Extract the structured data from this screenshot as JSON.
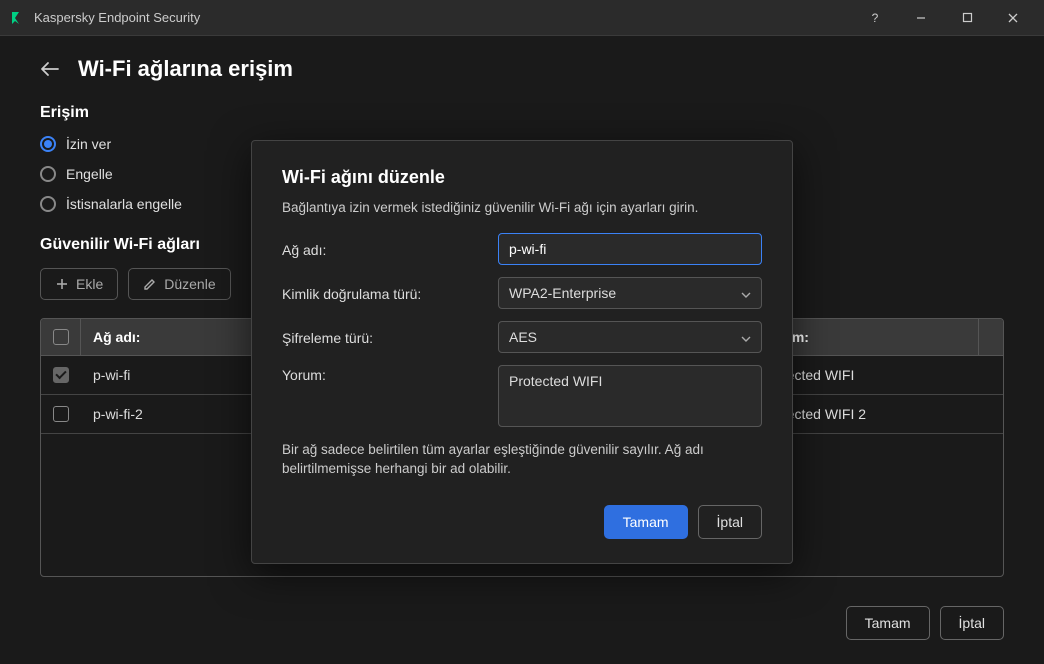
{
  "app": {
    "title": "Kaspersky Endpoint Security"
  },
  "page": {
    "title": "Wi-Fi ağlarına erişim",
    "access_section_label": "Erişim",
    "radios": {
      "allow": "İzin ver",
      "block": "Engelle",
      "block_exceptions": "İstisnalarla engelle"
    },
    "trusted_label": "Güvenilir Wi-Fi ağları",
    "toolbar": {
      "add": "Ekle",
      "edit": "Düzenle"
    },
    "table": {
      "header_name": "Ağ adı:",
      "header_comment": "Yorum:",
      "rows": [
        {
          "name": "p-wi-fi",
          "comment": "Protected WIFI",
          "checked": true
        },
        {
          "name": "p-wi-fi-2",
          "comment": "Protected WIFI 2",
          "checked": false
        }
      ]
    },
    "buttons": {
      "ok": "Tamam",
      "cancel": "İptal"
    }
  },
  "modal": {
    "title": "Wi-Fi ağını düzenle",
    "description": "Bağlantıya izin vermek istediğiniz güvenilir Wi-Fi ağı için ayarları girin.",
    "labels": {
      "network_name": "Ağ adı:",
      "auth_type": "Kimlik doğrulama türü:",
      "encryption_type": "Şifreleme türü:",
      "comment": "Yorum:"
    },
    "values": {
      "network_name": "p-wi-fi",
      "auth_type": "WPA2-Enterprise",
      "encryption_type": "AES",
      "comment": "Protected WIFI"
    },
    "note": "Bir ağ sadece belirtilen tüm ayarlar eşleştiğinde güvenilir sayılır. Ağ adı belirtilmemişse herhangi bir ad olabilir.",
    "buttons": {
      "ok": "Tamam",
      "cancel": "İptal"
    }
  }
}
